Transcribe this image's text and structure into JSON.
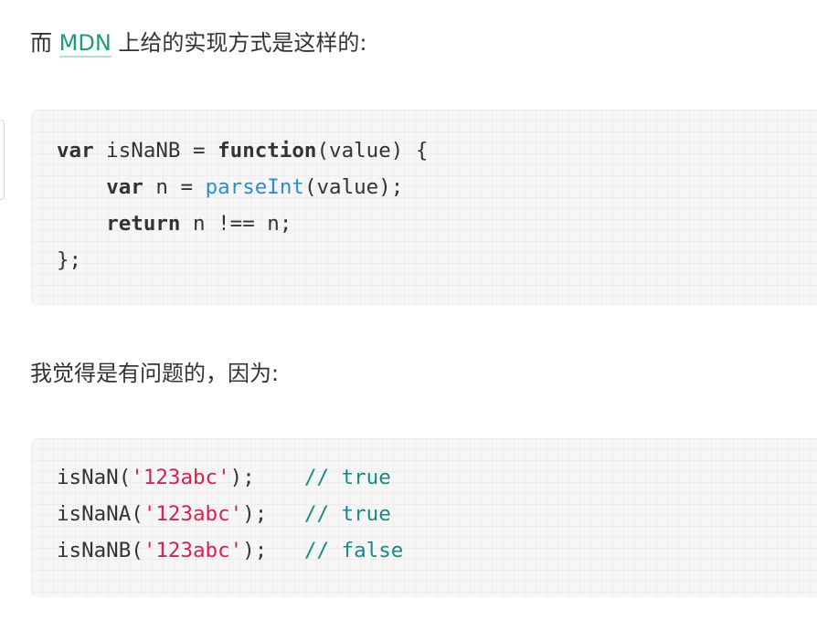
{
  "para1": {
    "before": "而 ",
    "link": "MDN",
    "after": " 上给的实现方式是这样的:"
  },
  "code1": {
    "line1": {
      "kw1": "var",
      "t1": " isNaNB = ",
      "kw2": "function",
      "t2": "(value) {"
    },
    "line2": {
      "indent": "    ",
      "kw": "var",
      "t1": " n = ",
      "fn": "parseInt",
      "t2": "(value);"
    },
    "line3": {
      "indent": "    ",
      "kw": "return",
      "t1": " n !== n;"
    },
    "line4": {
      "t": "};"
    }
  },
  "para2": "我觉得是有问题的，因为:",
  "code2": {
    "rows": [
      {
        "pre": "isNaN(",
        "str": "'123abc'",
        "post": ");    ",
        "comment": "// true"
      },
      {
        "pre": "isNaNA(",
        "str": "'123abc'",
        "post": ");   ",
        "comment": "// true"
      },
      {
        "pre": "isNaNB(",
        "str": "'123abc'",
        "post": ");   ",
        "comment": "// false"
      }
    ]
  }
}
